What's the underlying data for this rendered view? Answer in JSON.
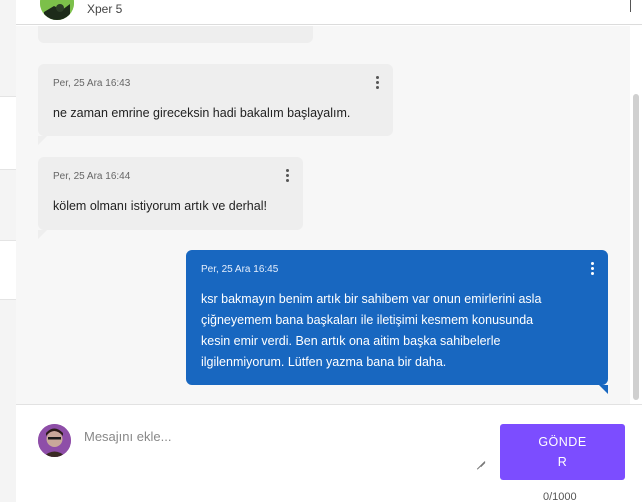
{
  "header": {
    "contact_name": "Xper 5"
  },
  "messages": [
    {
      "direction": "incoming",
      "timestamp": "Per, 25 Ara 16:43",
      "text": [
        "ne zaman emrine gireceksin hadi bakalım başlayalım."
      ]
    },
    {
      "direction": "incoming",
      "timestamp": "Per, 25 Ara 16:44",
      "text": [
        "kölem olmanı istiyorum artık ve derhal!"
      ]
    },
    {
      "direction": "outgoing",
      "timestamp": "Per, 25 Ara 16:45",
      "text": [
        "ksr bakmayın benim artık bir sahibem var onun emirlerini asla",
        "çiğneyemem bana başkaları ile iletişimi kesmem konusunda",
        "kesin emir verdi. Ben artık ona aitim başka sahibelerle",
        "ilgilenmiyorum. Lütfen yazma bana bir daha."
      ]
    }
  ],
  "composer": {
    "placeholder": "Mesajını ekle...",
    "value": "",
    "send_label": "GÖNDER",
    "counter": "0/1000"
  },
  "colors": {
    "outgoing_bubble": "#1867c0",
    "incoming_bubble": "#eeeeee",
    "send_button": "#7c4dff"
  }
}
